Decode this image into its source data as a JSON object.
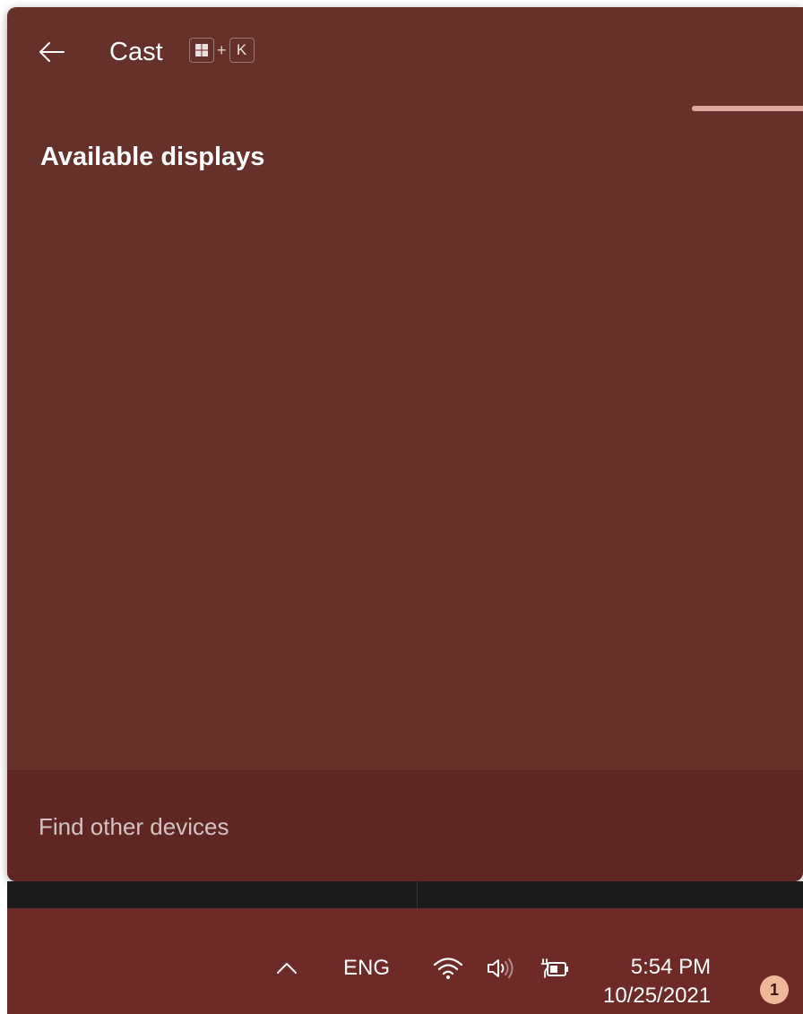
{
  "flyout": {
    "title": "Cast",
    "shortcut": {
      "key1_icon": "windows-key-icon",
      "plus": "+",
      "key2": "K"
    },
    "section_title": "Available displays",
    "displays": [],
    "footer_link": "Find other devices"
  },
  "taskbar": {
    "tray_overflow_icon": "chevron-up-icon",
    "language": "ENG",
    "wifi_icon": "wifi-icon",
    "volume_icon": "volume-icon",
    "battery_icon": "battery-charging-icon",
    "time": "5:54 PM",
    "date": "10/25/2021",
    "notification_count": "1"
  },
  "colors": {
    "flyout_bg": "#66302b",
    "footer_bg": "#5e2723",
    "taskbar_bg": "#6e2a26",
    "accent": "#e0a89d",
    "badge": "#f0b89a"
  }
}
